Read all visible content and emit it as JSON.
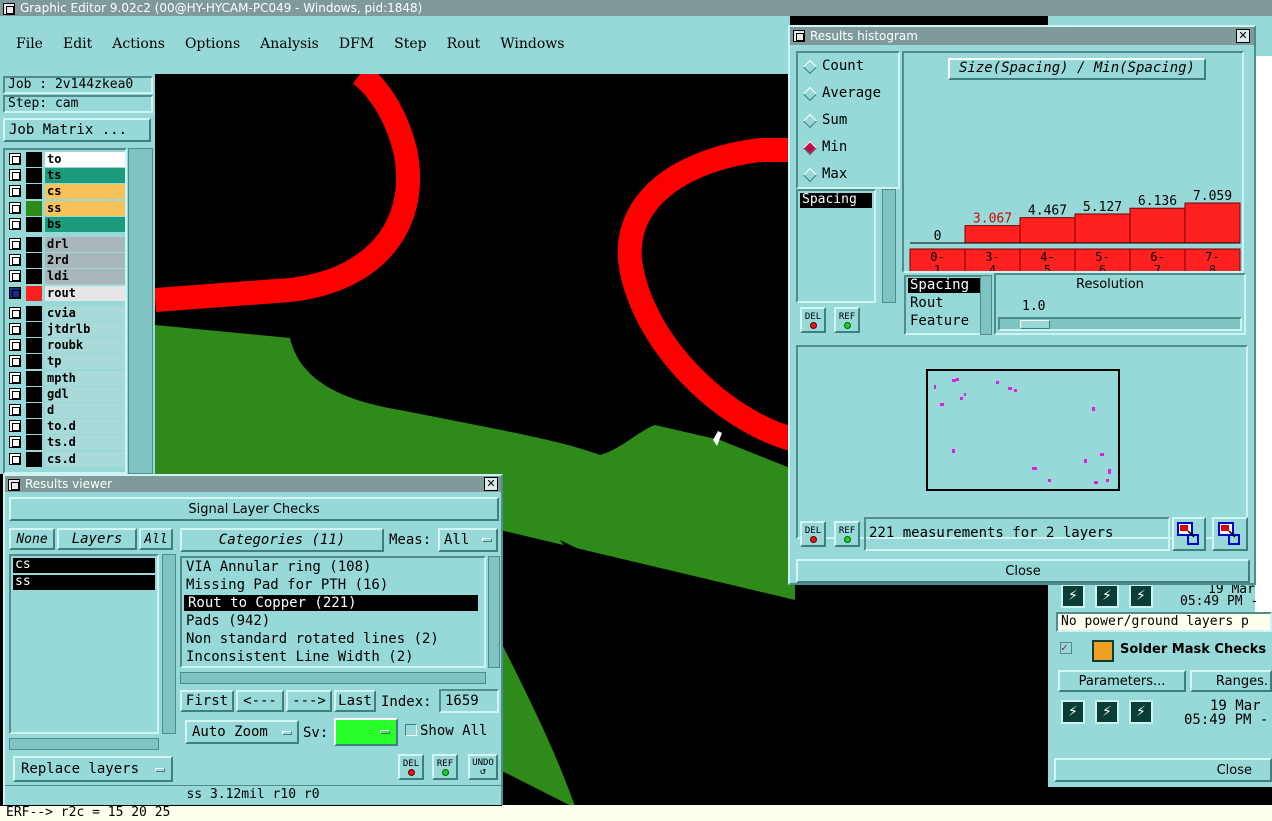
{
  "window": {
    "title": "Graphic Editor 9.02c2 (00@HY-HYCAM-PC049 - Windows, pid:1848)"
  },
  "menu": [
    "File",
    "Edit",
    "Actions",
    "Options",
    "Analysis",
    "DFM",
    "Step",
    "Rout",
    "Windows"
  ],
  "job": {
    "job_label": "Job : 2v144zkea0",
    "step_label": "Step: cam",
    "matrix_button": "Job Matrix ..."
  },
  "layers": [
    {
      "name": "to",
      "color": "#ffffff",
      "swatch": "#000000"
    },
    {
      "name": "ts",
      "color": "#1c9c7a",
      "swatch": "#000000"
    },
    {
      "name": "cs",
      "color": "#f7c35a",
      "swatch": "#000000"
    },
    {
      "name": "ss",
      "color": "#f7c35a",
      "swatch": "#2e8b1a"
    },
    {
      "name": "bs",
      "color": "#1c9c7a",
      "swatch": "#000000"
    },
    {
      "name": "drl",
      "color": "#a9b7bb",
      "swatch": "#000000"
    },
    {
      "name": "2rd",
      "color": "#a9b7bb",
      "swatch": "#000000"
    },
    {
      "name": "ldi",
      "color": "#a9b7bb",
      "swatch": "#000000"
    },
    {
      "name": "rout",
      "color": "#e6e6e6",
      "swatch": "#ff1f1f"
    },
    {
      "name": "cvia",
      "color": "#a9d9d8",
      "swatch": "#000000"
    },
    {
      "name": "jtdrlb",
      "color": "#a9d9d8",
      "swatch": "#000000"
    },
    {
      "name": "roubk",
      "color": "#a9d9d8",
      "swatch": "#000000"
    },
    {
      "name": "tp",
      "color": "#a9d9d8",
      "swatch": "#000000"
    },
    {
      "name": "mpth",
      "color": "#a9d9d8",
      "swatch": "#000000"
    },
    {
      "name": "gdl",
      "color": "#a9d9d8",
      "swatch": "#000000"
    },
    {
      "name": "d",
      "color": "#a9d9d8",
      "swatch": "#000000"
    },
    {
      "name": "to.d",
      "color": "#a9d9d8",
      "swatch": "#000000"
    },
    {
      "name": "ts.d",
      "color": "#a9d9d8",
      "swatch": "#000000"
    },
    {
      "name": "cs.d",
      "color": "#a9d9d8",
      "swatch": "#000000"
    }
  ],
  "results_viewer": {
    "title": "Results viewer",
    "header": "Signal Layer Checks",
    "none_btn": "None",
    "layers_btn": "Layers",
    "all_btn": "All",
    "layer_list": [
      "cs",
      "ss"
    ],
    "categories_btn": "Categories (11)",
    "meas_label": "Meas:",
    "meas_value": "All",
    "categories": [
      "VIA Annular ring (108)",
      "Missing Pad for PTH (16)",
      "Rout to Copper (221)",
      "Pads (942)",
      "Non standard rotated lines (2)",
      "Inconsistent Line Width (2)"
    ],
    "first": "First",
    "prev": "<---",
    "next": "--->",
    "last": "Last",
    "index_label": "Index:",
    "index_value": "1659",
    "auto_zoom": "Auto Zoom",
    "sv_label": "Sv:",
    "show_all": "Show All",
    "replace_layers": "Replace layers",
    "del": "DEL",
    "ref": "REF",
    "undo": "UNDO",
    "status": "ss 3.12mil  r10  r0",
    "command": "ERF--> r2c = 15 20 25"
  },
  "histogram": {
    "title": "Results histogram",
    "modes": [
      "Count",
      "Average",
      "Sum",
      "Min",
      "Max"
    ],
    "selected_mode": "Min",
    "attr_list": [
      "Spacing"
    ],
    "chart_title": "Size(Spacing) / Min(Spacing)",
    "bars": [
      {
        "range": [
          "0-",
          "1"
        ],
        "value": "0",
        "num": 0
      },
      {
        "range": [
          "3-",
          "4"
        ],
        "value": "3.067",
        "num": 3.067,
        "highlight": true
      },
      {
        "range": [
          "4-",
          "5"
        ],
        "value": "4.467",
        "num": 4.467
      },
      {
        "range": [
          "5-",
          "6"
        ],
        "value": "5.127",
        "num": 5.127
      },
      {
        "range": [
          "6-",
          "7"
        ],
        "value": "6.136",
        "num": 6.136
      },
      {
        "range": [
          "7-",
          "8"
        ],
        "value": "7.059",
        "num": 7.059
      }
    ],
    "group_list": [
      "Spacing",
      "Rout",
      "Feature"
    ],
    "resolution_label": "Resolution",
    "resolution_value": "1.0",
    "del": "DEL",
    "ref": "REF",
    "measurements": "221 measurements for 2 layers",
    "close": "Close"
  },
  "right_panel": {
    "date1": "19 Mar",
    "time1": "05:49 PM -",
    "no_power": "No power/ground layers p",
    "solder_mask": "Solder Mask Checks",
    "parameters": "Parameters...",
    "ranges": "Ranges.",
    "date2": "19 Mar",
    "time2": "05:49 PM -",
    "close": "Close"
  },
  "colors": {
    "teal": "#96d9d8",
    "rout": "#ff0000",
    "copper": "#2e8b1a",
    "title": "#7f9a9a"
  }
}
